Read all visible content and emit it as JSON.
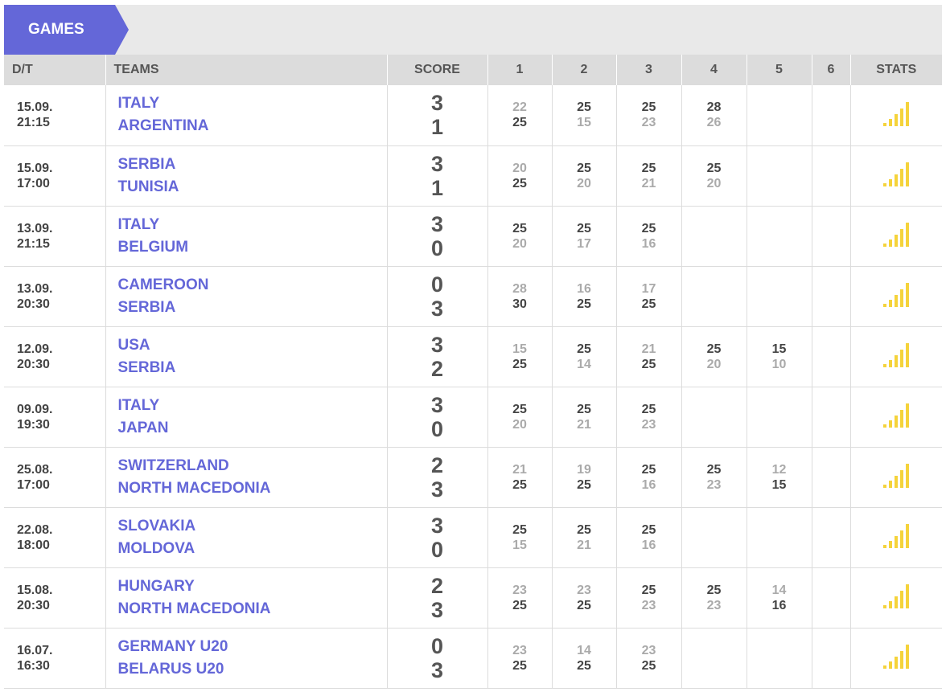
{
  "tab": {
    "label": "GAMES"
  },
  "headers": [
    "D/T",
    "TEAMS",
    "SCORE",
    "1",
    "2",
    "3",
    "4",
    "5",
    "6",
    "STATS"
  ],
  "colors": {
    "accent": "#6467d8",
    "stats_bar": "#f5d33b",
    "winner_text": "#444444",
    "loser_text": "#aaaaaa"
  },
  "stats_icon": "signal-bars-icon",
  "games": [
    {
      "date": "15.09.",
      "time": "21:15",
      "team1": "ITALY",
      "team2": "ARGENTINA",
      "score1": "3",
      "score2": "1",
      "sets": [
        [
          "22",
          "25"
        ],
        [
          "25",
          "15"
        ],
        [
          "25",
          "23"
        ],
        [
          "28",
          "26"
        ]
      ]
    },
    {
      "date": "15.09.",
      "time": "17:00",
      "team1": "SERBIA",
      "team2": "TUNISIA",
      "score1": "3",
      "score2": "1",
      "sets": [
        [
          "20",
          "25"
        ],
        [
          "25",
          "20"
        ],
        [
          "25",
          "21"
        ],
        [
          "25",
          "20"
        ]
      ]
    },
    {
      "date": "13.09.",
      "time": "21:15",
      "team1": "ITALY",
      "team2": "BELGIUM",
      "score1": "3",
      "score2": "0",
      "sets": [
        [
          "25",
          "20"
        ],
        [
          "25",
          "17"
        ],
        [
          "25",
          "16"
        ]
      ]
    },
    {
      "date": "13.09.",
      "time": "20:30",
      "team1": "CAMEROON",
      "team2": "SERBIA",
      "score1": "0",
      "score2": "3",
      "sets": [
        [
          "28",
          "30"
        ],
        [
          "16",
          "25"
        ],
        [
          "17",
          "25"
        ]
      ]
    },
    {
      "date": "12.09.",
      "time": "20:30",
      "team1": "USA",
      "team2": "SERBIA",
      "score1": "3",
      "score2": "2",
      "sets": [
        [
          "15",
          "25"
        ],
        [
          "25",
          "14"
        ],
        [
          "21",
          "25"
        ],
        [
          "25",
          "20"
        ],
        [
          "15",
          "10"
        ]
      ]
    },
    {
      "date": "09.09.",
      "time": "19:30",
      "team1": "ITALY",
      "team2": "JAPAN",
      "score1": "3",
      "score2": "0",
      "sets": [
        [
          "25",
          "20"
        ],
        [
          "25",
          "21"
        ],
        [
          "25",
          "23"
        ]
      ]
    },
    {
      "date": "25.08.",
      "time": "17:00",
      "team1": "SWITZERLAND",
      "team2": "NORTH MACEDONIA",
      "score1": "2",
      "score2": "3",
      "sets": [
        [
          "21",
          "25"
        ],
        [
          "19",
          "25"
        ],
        [
          "25",
          "16"
        ],
        [
          "25",
          "23"
        ],
        [
          "12",
          "15"
        ]
      ]
    },
    {
      "date": "22.08.",
      "time": "18:00",
      "team1": "SLOVAKIA",
      "team2": "MOLDOVA",
      "score1": "3",
      "score2": "0",
      "sets": [
        [
          "25",
          "15"
        ],
        [
          "25",
          "21"
        ],
        [
          "25",
          "16"
        ]
      ]
    },
    {
      "date": "15.08.",
      "time": "20:30",
      "team1": "HUNGARY",
      "team2": "NORTH MACEDONIA",
      "score1": "2",
      "score2": "3",
      "sets": [
        [
          "23",
          "25"
        ],
        [
          "23",
          "25"
        ],
        [
          "25",
          "23"
        ],
        [
          "25",
          "23"
        ],
        [
          "14",
          "16"
        ]
      ]
    },
    {
      "date": "16.07.",
      "time": "16:30",
      "team1": "GERMANY U20",
      "team2": "BELARUS U20",
      "score1": "0",
      "score2": "3",
      "sets": [
        [
          "23",
          "25"
        ],
        [
          "14",
          "25"
        ],
        [
          "23",
          "25"
        ]
      ]
    }
  ]
}
